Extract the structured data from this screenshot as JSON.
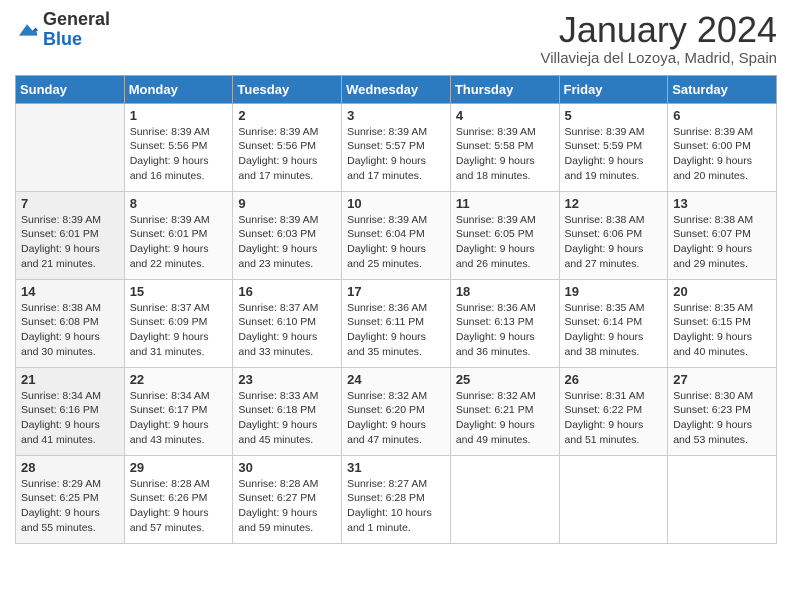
{
  "header": {
    "logo_general": "General",
    "logo_blue": "Blue",
    "month_title": "January 2024",
    "location": "Villavieja del Lozoya, Madrid, Spain"
  },
  "weekdays": [
    "Sunday",
    "Monday",
    "Tuesday",
    "Wednesday",
    "Thursday",
    "Friday",
    "Saturday"
  ],
  "weeks": [
    [
      {
        "day": "",
        "lines": []
      },
      {
        "day": "1",
        "lines": [
          "Sunrise: 8:39 AM",
          "Sunset: 5:56 PM",
          "Daylight: 9 hours",
          "and 16 minutes."
        ]
      },
      {
        "day": "2",
        "lines": [
          "Sunrise: 8:39 AM",
          "Sunset: 5:56 PM",
          "Daylight: 9 hours",
          "and 17 minutes."
        ]
      },
      {
        "day": "3",
        "lines": [
          "Sunrise: 8:39 AM",
          "Sunset: 5:57 PM",
          "Daylight: 9 hours",
          "and 17 minutes."
        ]
      },
      {
        "day": "4",
        "lines": [
          "Sunrise: 8:39 AM",
          "Sunset: 5:58 PM",
          "Daylight: 9 hours",
          "and 18 minutes."
        ]
      },
      {
        "day": "5",
        "lines": [
          "Sunrise: 8:39 AM",
          "Sunset: 5:59 PM",
          "Daylight: 9 hours",
          "and 19 minutes."
        ]
      },
      {
        "day": "6",
        "lines": [
          "Sunrise: 8:39 AM",
          "Sunset: 6:00 PM",
          "Daylight: 9 hours",
          "and 20 minutes."
        ]
      }
    ],
    [
      {
        "day": "7",
        "lines": [
          "Sunrise: 8:39 AM",
          "Sunset: 6:01 PM",
          "Daylight: 9 hours",
          "and 21 minutes."
        ]
      },
      {
        "day": "8",
        "lines": [
          "Sunrise: 8:39 AM",
          "Sunset: 6:01 PM",
          "Daylight: 9 hours",
          "and 22 minutes."
        ]
      },
      {
        "day": "9",
        "lines": [
          "Sunrise: 8:39 AM",
          "Sunset: 6:03 PM",
          "Daylight: 9 hours",
          "and 23 minutes."
        ]
      },
      {
        "day": "10",
        "lines": [
          "Sunrise: 8:39 AM",
          "Sunset: 6:04 PM",
          "Daylight: 9 hours",
          "and 25 minutes."
        ]
      },
      {
        "day": "11",
        "lines": [
          "Sunrise: 8:39 AM",
          "Sunset: 6:05 PM",
          "Daylight: 9 hours",
          "and 26 minutes."
        ]
      },
      {
        "day": "12",
        "lines": [
          "Sunrise: 8:38 AM",
          "Sunset: 6:06 PM",
          "Daylight: 9 hours",
          "and 27 minutes."
        ]
      },
      {
        "day": "13",
        "lines": [
          "Sunrise: 8:38 AM",
          "Sunset: 6:07 PM",
          "Daylight: 9 hours",
          "and 29 minutes."
        ]
      }
    ],
    [
      {
        "day": "14",
        "lines": [
          "Sunrise: 8:38 AM",
          "Sunset: 6:08 PM",
          "Daylight: 9 hours",
          "and 30 minutes."
        ]
      },
      {
        "day": "15",
        "lines": [
          "Sunrise: 8:37 AM",
          "Sunset: 6:09 PM",
          "Daylight: 9 hours",
          "and 31 minutes."
        ]
      },
      {
        "day": "16",
        "lines": [
          "Sunrise: 8:37 AM",
          "Sunset: 6:10 PM",
          "Daylight: 9 hours",
          "and 33 minutes."
        ]
      },
      {
        "day": "17",
        "lines": [
          "Sunrise: 8:36 AM",
          "Sunset: 6:11 PM",
          "Daylight: 9 hours",
          "and 35 minutes."
        ]
      },
      {
        "day": "18",
        "lines": [
          "Sunrise: 8:36 AM",
          "Sunset: 6:13 PM",
          "Daylight: 9 hours",
          "and 36 minutes."
        ]
      },
      {
        "day": "19",
        "lines": [
          "Sunrise: 8:35 AM",
          "Sunset: 6:14 PM",
          "Daylight: 9 hours",
          "and 38 minutes."
        ]
      },
      {
        "day": "20",
        "lines": [
          "Sunrise: 8:35 AM",
          "Sunset: 6:15 PM",
          "Daylight: 9 hours",
          "and 40 minutes."
        ]
      }
    ],
    [
      {
        "day": "21",
        "lines": [
          "Sunrise: 8:34 AM",
          "Sunset: 6:16 PM",
          "Daylight: 9 hours",
          "and 41 minutes."
        ]
      },
      {
        "day": "22",
        "lines": [
          "Sunrise: 8:34 AM",
          "Sunset: 6:17 PM",
          "Daylight: 9 hours",
          "and 43 minutes."
        ]
      },
      {
        "day": "23",
        "lines": [
          "Sunrise: 8:33 AM",
          "Sunset: 6:18 PM",
          "Daylight: 9 hours",
          "and 45 minutes."
        ]
      },
      {
        "day": "24",
        "lines": [
          "Sunrise: 8:32 AM",
          "Sunset: 6:20 PM",
          "Daylight: 9 hours",
          "and 47 minutes."
        ]
      },
      {
        "day": "25",
        "lines": [
          "Sunrise: 8:32 AM",
          "Sunset: 6:21 PM",
          "Daylight: 9 hours",
          "and 49 minutes."
        ]
      },
      {
        "day": "26",
        "lines": [
          "Sunrise: 8:31 AM",
          "Sunset: 6:22 PM",
          "Daylight: 9 hours",
          "and 51 minutes."
        ]
      },
      {
        "day": "27",
        "lines": [
          "Sunrise: 8:30 AM",
          "Sunset: 6:23 PM",
          "Daylight: 9 hours",
          "and 53 minutes."
        ]
      }
    ],
    [
      {
        "day": "28",
        "lines": [
          "Sunrise: 8:29 AM",
          "Sunset: 6:25 PM",
          "Daylight: 9 hours",
          "and 55 minutes."
        ]
      },
      {
        "day": "29",
        "lines": [
          "Sunrise: 8:28 AM",
          "Sunset: 6:26 PM",
          "Daylight: 9 hours",
          "and 57 minutes."
        ]
      },
      {
        "day": "30",
        "lines": [
          "Sunrise: 8:28 AM",
          "Sunset: 6:27 PM",
          "Daylight: 9 hours",
          "and 59 minutes."
        ]
      },
      {
        "day": "31",
        "lines": [
          "Sunrise: 8:27 AM",
          "Sunset: 6:28 PM",
          "Daylight: 10 hours",
          "and 1 minute."
        ]
      },
      {
        "day": "",
        "lines": []
      },
      {
        "day": "",
        "lines": []
      },
      {
        "day": "",
        "lines": []
      }
    ]
  ]
}
